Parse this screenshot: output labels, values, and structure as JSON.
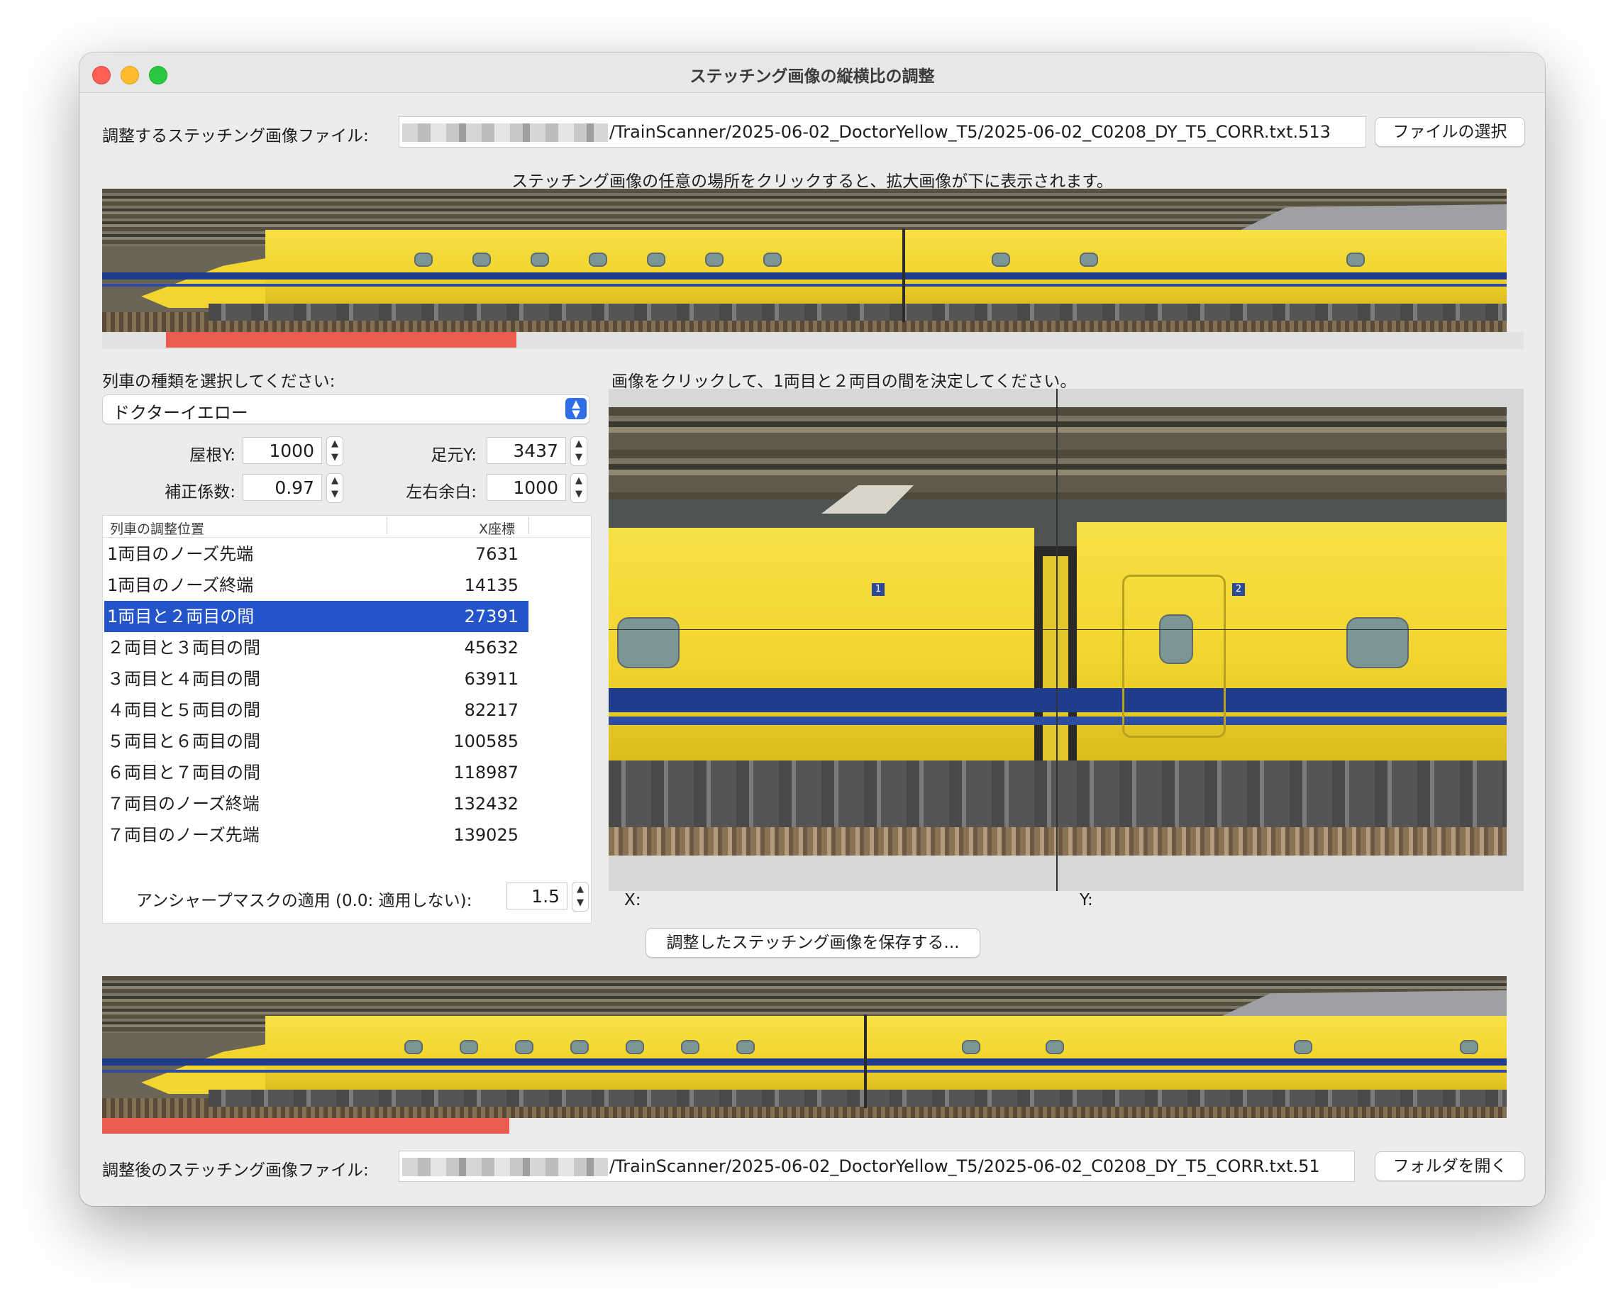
{
  "window": {
    "title": "ステッチング画像の縦横比の調整"
  },
  "source_file": {
    "label": "調整するステッチング画像ファイル:",
    "path_suffix": "/TrainScanner/2025-06-02_DoctorYellow_T5/2025-06-02_C0208_DY_T5_CORR.txt.513",
    "button": "ファイルの選択"
  },
  "hint": "ステッチング画像の任意の場所をクリックすると、拡大画像が下に表示されます。",
  "train_type": {
    "label": "列車の種類を選択してください:",
    "selected": "ドクターイエロー"
  },
  "params": {
    "roof_y": {
      "label": "屋根Y:",
      "value": "1000"
    },
    "foot_y": {
      "label": "足元Y:",
      "value": "3437"
    },
    "correction": {
      "label": "補正係数:",
      "value": "0.97"
    },
    "margin": {
      "label": "左右余白:",
      "value": "1000"
    }
  },
  "table": {
    "headers": [
      "列車の調整位置",
      "X座標"
    ],
    "rows": [
      {
        "name": "1両目のノーズ先端",
        "x": "7631"
      },
      {
        "name": "1両目のノーズ終端",
        "x": "14135"
      },
      {
        "name": "1両目と２両目の間",
        "x": "27391"
      },
      {
        "name": "２両目と３両目の間",
        "x": "45632"
      },
      {
        "name": "３両目と４両目の間",
        "x": "63911"
      },
      {
        "name": "４両目と５両目の間",
        "x": "82217"
      },
      {
        "name": "５両目と６両目の間",
        "x": "100585"
      },
      {
        "name": "６両目と７両目の間",
        "x": "118987"
      },
      {
        "name": "７両目のノーズ終端",
        "x": "132432"
      },
      {
        "name": "７両目のノーズ先端",
        "x": "139025"
      }
    ],
    "selected_index": 2
  },
  "zoom": {
    "instruction": "画像をクリックして、1両目と２両目の間を決定してください。",
    "car_numbers": [
      "1",
      "2"
    ],
    "x_label": "X:",
    "y_label": "Y:"
  },
  "unsharp": {
    "label": "アンシャープマスクの適用 (0.0: 適用しない):",
    "value": "1.5"
  },
  "save_button": "調整したステッチング画像を保存する...",
  "output_file": {
    "label": "調整後のステッチング画像ファイル:",
    "path_suffix": "/TrainScanner/2025-06-02_DoctorYellow_T5/2025-06-02_C0208_DY_T5_CORR.txt.51",
    "button": "フォルダを開く"
  },
  "colors": {
    "train_yellow": "#f2d52e",
    "stripe_blue": "#1f3d8a",
    "selection": "#2354c9",
    "progress_red": "#eb5b50"
  },
  "icons": [
    "close-icon",
    "minimize-icon",
    "maximize-icon",
    "chevron-updown-icon",
    "stepper-icon"
  ]
}
